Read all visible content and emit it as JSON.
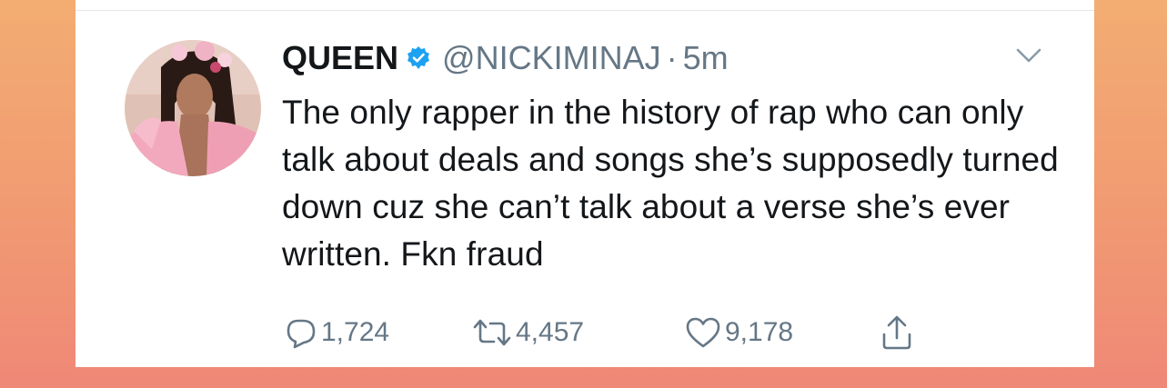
{
  "tweet": {
    "display_name": "QUEEN",
    "handle": "@NICKIMINAJ",
    "separator": "·",
    "time": "5m",
    "text": "The only rapper in the history of rap who can only talk about deals and songs she’s supposedly turned down cuz she can’t talk about a verse she’s ever written. Fkn fraud",
    "verified": true,
    "avatar_icon": "profile-photo",
    "menu_icon": "chevron-down-icon"
  },
  "actions": {
    "reply": {
      "icon": "reply-icon",
      "count": "1,724"
    },
    "retweet": {
      "icon": "retweet-icon",
      "count": "4,457"
    },
    "like": {
      "icon": "heart-icon",
      "count": "9,178"
    },
    "share": {
      "icon": "share-icon"
    }
  },
  "colors": {
    "background_top": "#f3ad72",
    "background_bottom": "#ef8877",
    "card": "#ffffff",
    "text": "#14171a",
    "muted": "#657786",
    "verified": "#1da1f2"
  }
}
